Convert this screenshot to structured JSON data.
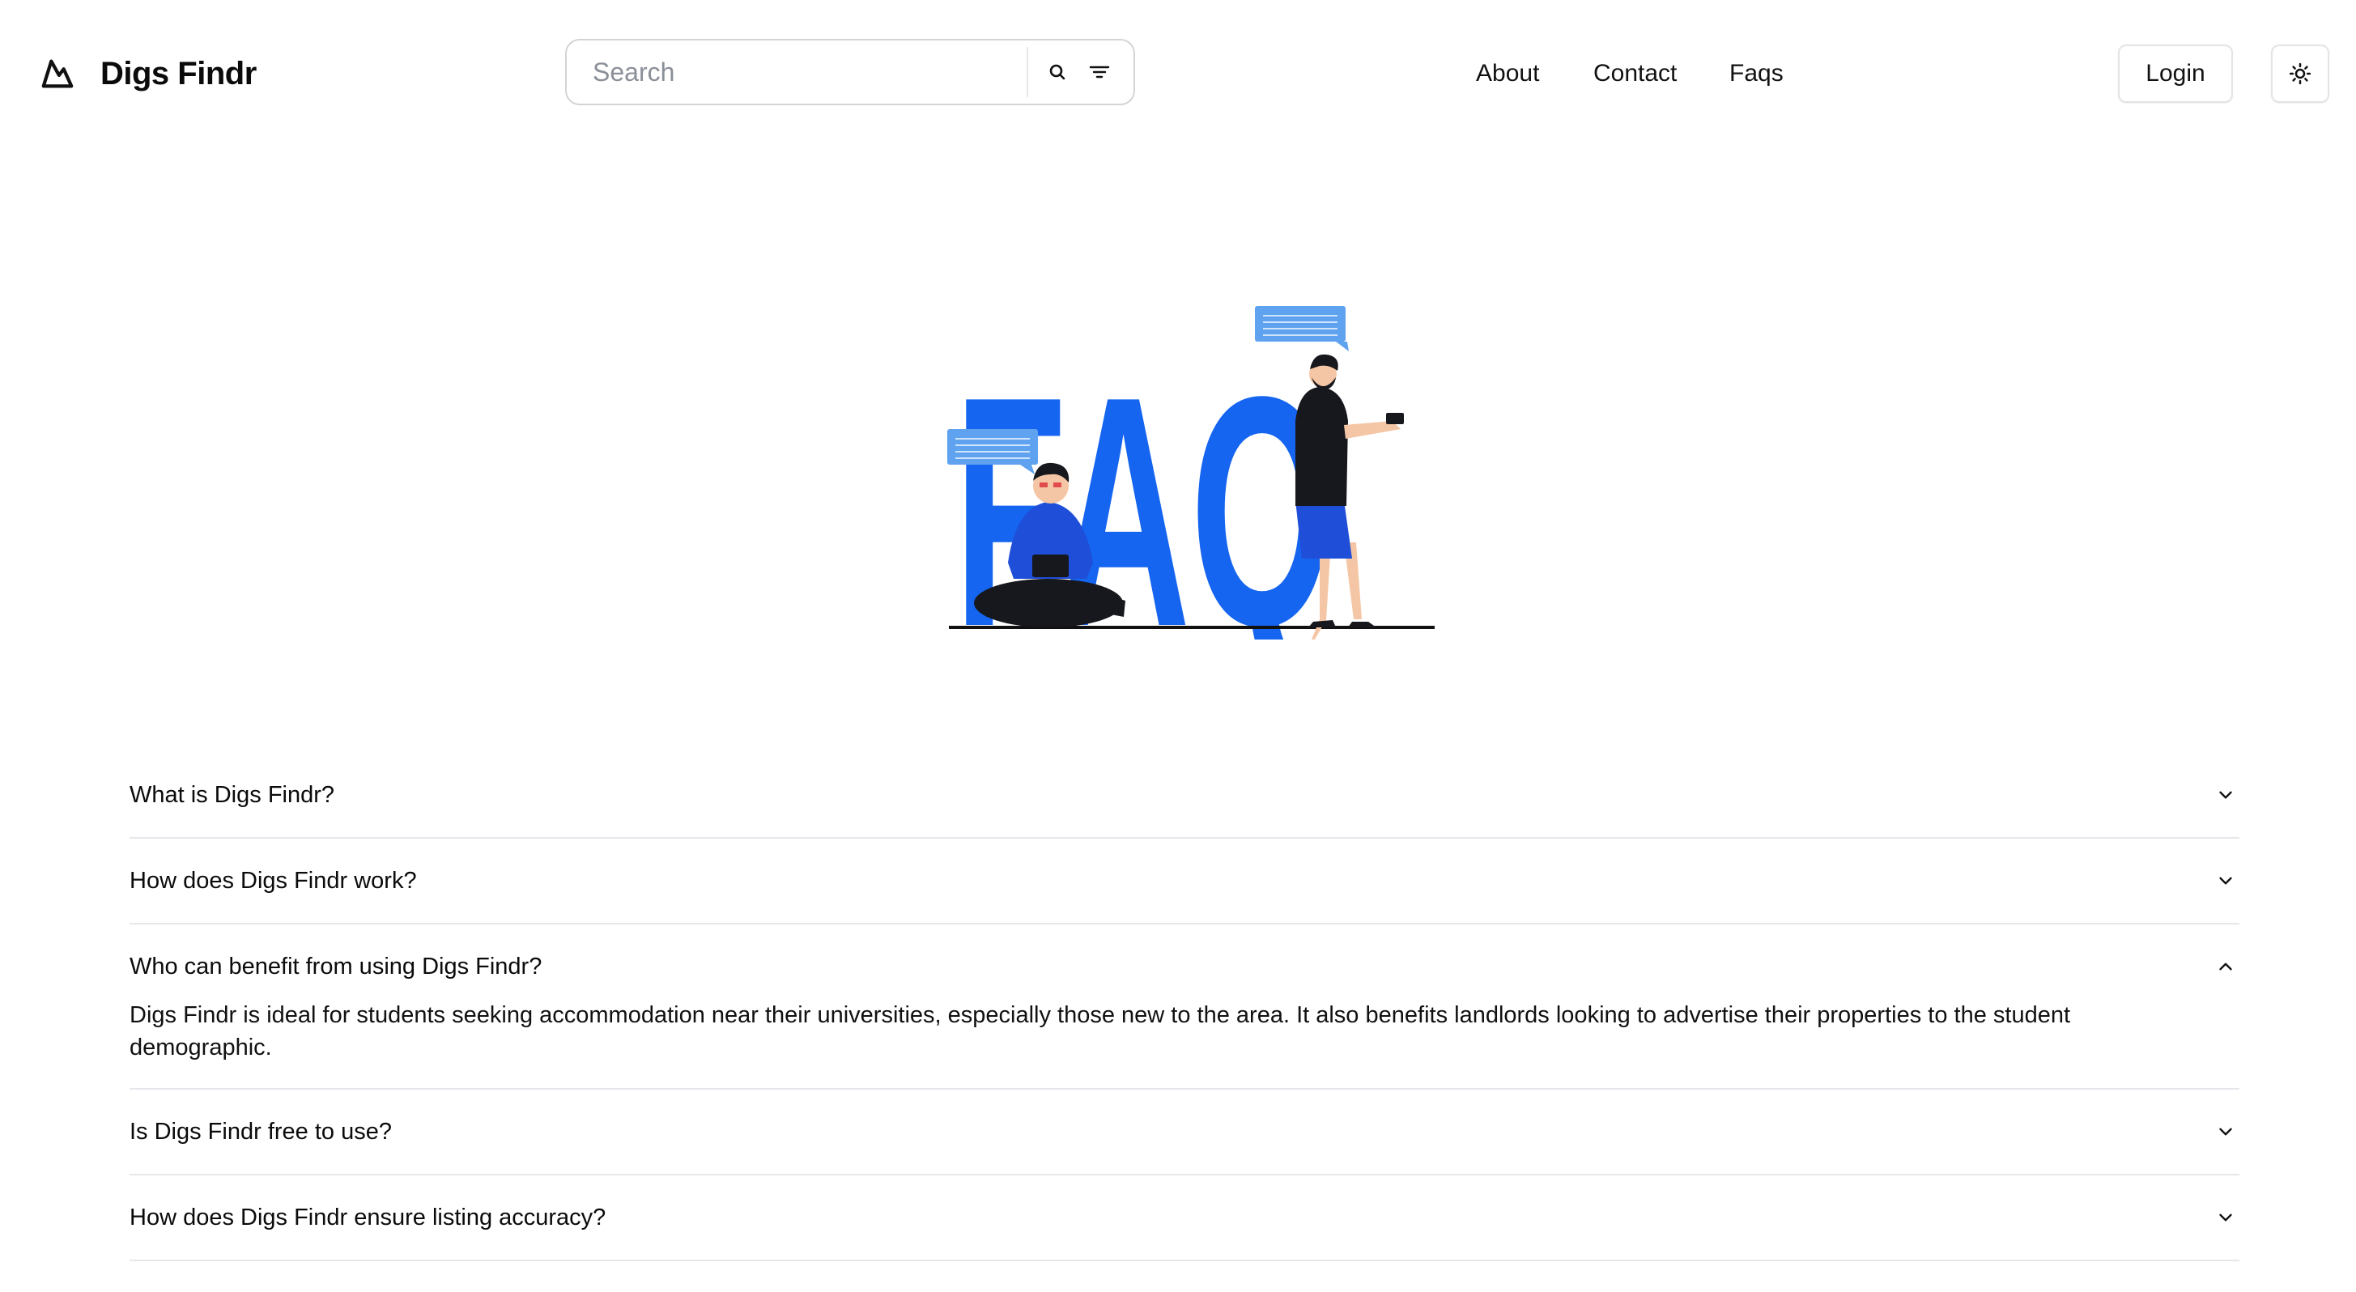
{
  "brand": {
    "name": "Digs Findr",
    "logo_icon": "mountain-icon"
  },
  "search": {
    "placeholder": "Search",
    "value": "",
    "icons": [
      "search-icon",
      "filter-icon"
    ]
  },
  "nav": {
    "items": [
      {
        "label": "About"
      },
      {
        "label": "Contact"
      },
      {
        "label": "Faqs"
      }
    ]
  },
  "header_actions": {
    "login_label": "Login",
    "theme_icon": "sun-icon"
  },
  "hero": {
    "illustration_text": "FAQ",
    "accent_color": "#1565f0"
  },
  "faq": {
    "items": [
      {
        "question": "What is Digs Findr?",
        "expanded": false,
        "answer": ""
      },
      {
        "question": "How does Digs Findr work?",
        "expanded": false,
        "answer": ""
      },
      {
        "question": "Who can benefit from using Digs Findr?",
        "expanded": true,
        "answer": "Digs Findr is ideal for students seeking accommodation near their universities, especially those new to the area. It also benefits landlords looking to advertise their properties to the student demographic."
      },
      {
        "question": "Is Digs Findr free to use?",
        "expanded": false,
        "answer": ""
      },
      {
        "question": "How does Digs Findr ensure listing accuracy?",
        "expanded": false,
        "answer": ""
      }
    ]
  }
}
